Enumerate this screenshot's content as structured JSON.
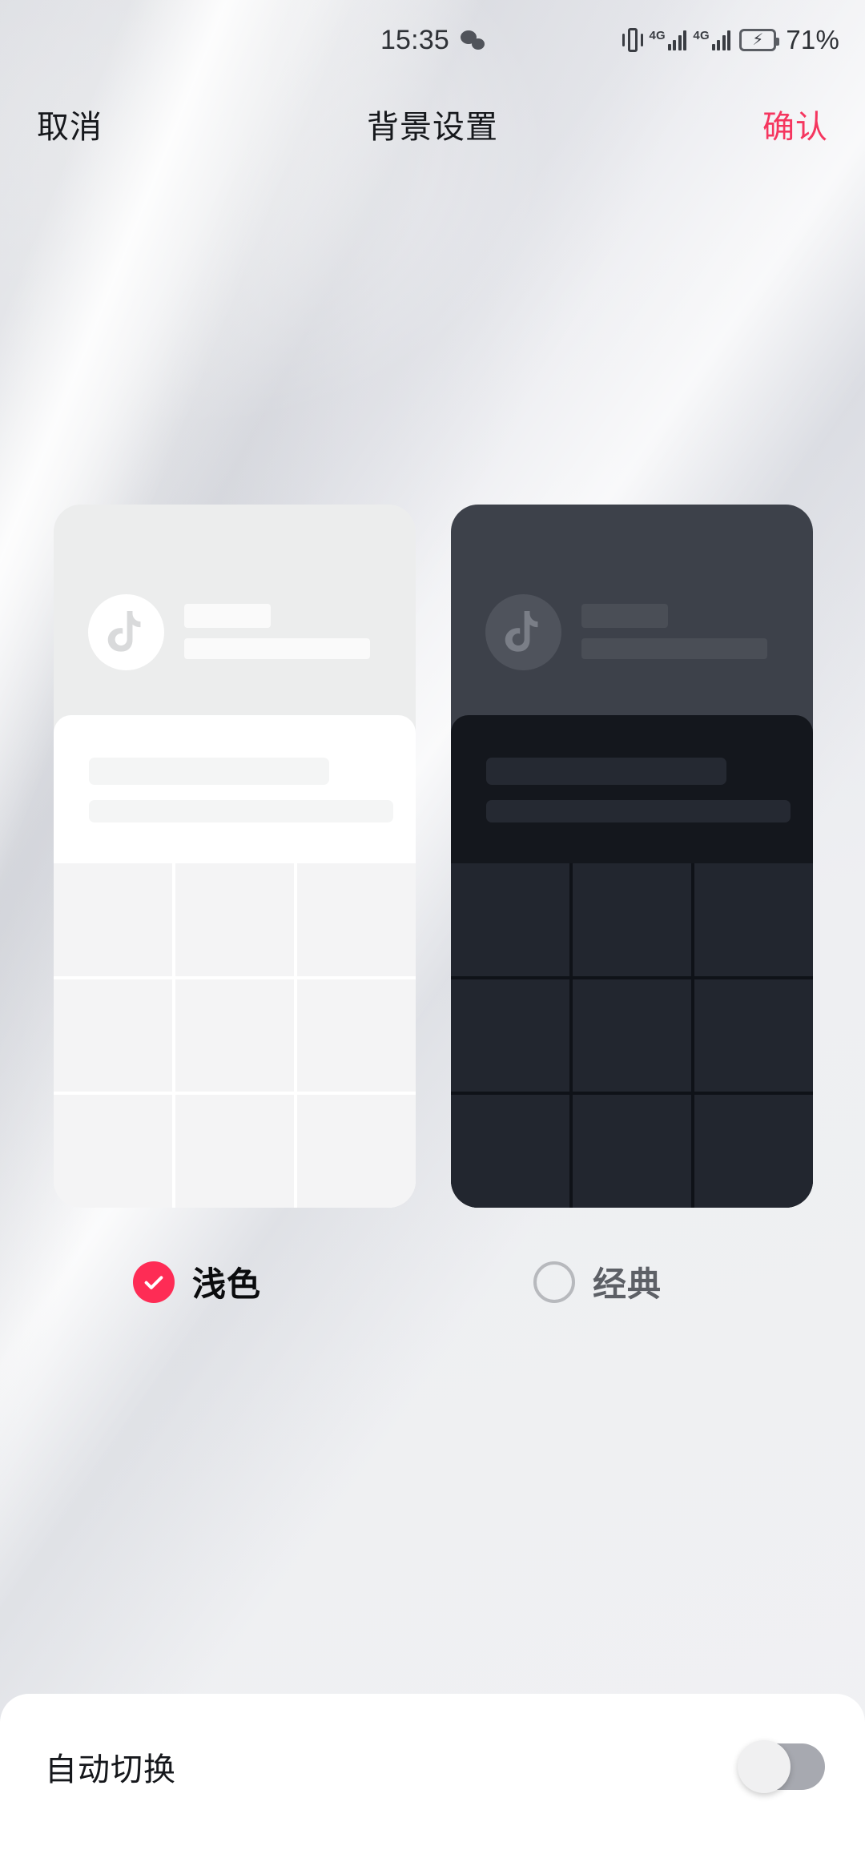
{
  "status_bar": {
    "time": "15:35",
    "notification_icon": "wechat-icon",
    "vibrate_icon": "vibrate-mode-icon",
    "sim1_network": "4G",
    "sim2_network": "4G",
    "battery_icon": "battery-charging-icon",
    "battery_percent": "71%"
  },
  "header": {
    "cancel_label": "取消",
    "title": "背景设置",
    "confirm_label": "确认",
    "confirm_color": "#f5365f"
  },
  "previews": [
    {
      "id": "light",
      "theme": "light",
      "avatar_icon": "douyin-music-note-icon",
      "card_bg": "#eceded",
      "panel_bg": "#ffffff",
      "cells": 9
    },
    {
      "id": "classic",
      "theme": "dark",
      "avatar_icon": "douyin-music-note-icon",
      "card_bg": "#3d414a",
      "panel_bg": "#14171d",
      "cells": 9
    }
  ],
  "options": [
    {
      "label": "浅色",
      "selected": true,
      "icon": "check-circle-icon",
      "accent": "#fe2c55"
    },
    {
      "label": "经典",
      "selected": false,
      "icon": "radio-empty-icon",
      "accent": "#b7b9bd"
    }
  ],
  "bottom": {
    "auto_switch_label": "自动切换",
    "auto_switch_state": "off",
    "switch_track_color": "#a7a9b0"
  }
}
